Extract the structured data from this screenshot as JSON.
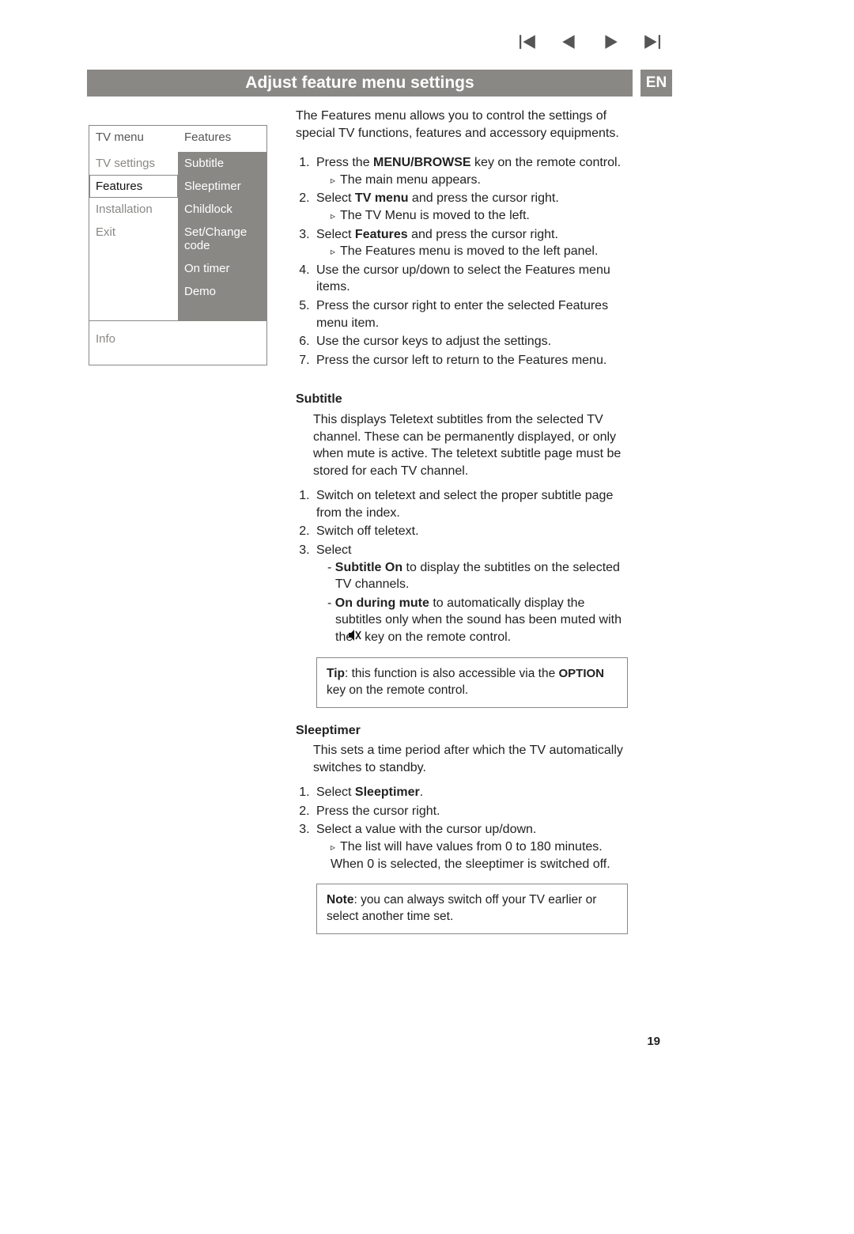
{
  "header": {
    "title": "Adjust feature menu settings",
    "lang": "EN"
  },
  "tvmenu": {
    "leftHeader": "TV menu",
    "rightHeader": "Features",
    "left": [
      "TV settings",
      "Features",
      "Installation",
      "Exit"
    ],
    "right": [
      "Subtitle",
      "Sleeptimer",
      "Childlock",
      "Set/Change code",
      "On timer",
      "Demo"
    ],
    "info": "Info"
  },
  "intro": "The Features menu allows you to control the settings of special TV functions, features and accessory equipments.",
  "steps": {
    "s1a": "Press the ",
    "s1b": "MENU/BROWSE",
    "s1c": " key on the remote control.",
    "s1r": "The main menu appears.",
    "s2a": "Select ",
    "s2b": "TV menu",
    "s2c": " and press the cursor right.",
    "s2r": "The TV Menu is moved to the left.",
    "s3a": "Select ",
    "s3b": "Features",
    "s3c": " and press the cursor right.",
    "s3r": "The Features menu is moved to the left panel.",
    "s4": "Use the cursor up/down to select the Features menu items.",
    "s5": "Press the cursor right to enter the selected Features menu item.",
    "s6": "Use the cursor keys to adjust the settings.",
    "s7": "Press the cursor left to return to the Features menu."
  },
  "subtitle": {
    "title": "Subtitle",
    "desc": "This displays Teletext subtitles from the selected TV channel. These can be permanently displayed, or only when mute is active. The teletext subtitle page must be stored for each TV channel.",
    "s1": "Switch on teletext and select the proper subtitle page from the index.",
    "s2": "Switch off teletext.",
    "s3": "Select",
    "opt1a": "Subtitle On",
    "opt1b": " to display the subtitles on the selected TV channels.",
    "opt2a": "On during mute",
    "opt2b": " to automatically display the subtitles only when the sound has been muted with the ",
    "opt2c": " key on the remote control.",
    "tipLabel": "Tip",
    "tipText": ": this function is also accessible via the ",
    "tipKey": "OPTION",
    "tipText2": " key on the remote control."
  },
  "sleeptimer": {
    "title": "Sleeptimer",
    "desc": "This sets a time period after which the TV automatically switches to standby.",
    "s1a": "Select ",
    "s1b": "Sleeptimer",
    "s1c": ".",
    "s2": "Press the cursor right.",
    "s3": "Select a value with the cursor up/down.",
    "s3r": "The list will have values from 0 to 180 minutes. When 0 is selected, the sleeptimer is switched off.",
    "noteLabel": "Note",
    "noteText": ": you can always switch off your TV earlier or select another time set."
  },
  "pagenum": "19"
}
